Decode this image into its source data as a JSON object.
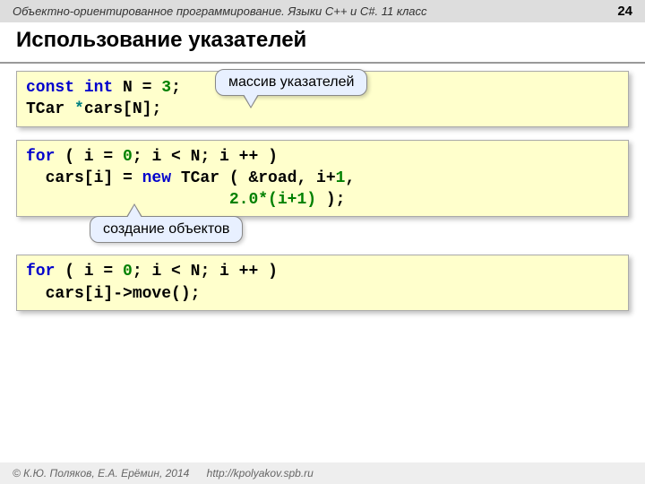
{
  "header": {
    "course": "Объектно-ориентированное программирование. Языки C++ и C#. 11 класс",
    "page": "24"
  },
  "title": "Использование указателей",
  "code1": {
    "l1_const": "const",
    "l1_int": "int",
    "l1_n": " N = ",
    "l1_3": "3",
    "l1_semi": ";",
    "l2_tcar": "TCar ",
    "l2_star": "*",
    "l2_rest": "cars[N];"
  },
  "callout1": "массив указателей",
  "code2": {
    "l1_for": "for",
    "l1_mid": " ( i = ",
    "l1_0": "0",
    "l1_end": "; i < N; i ++ )",
    "l2_pre": "  cars[i] = ",
    "l2_new": "new",
    "l2_mid": " TCar ( &road, i+",
    "l2_1": "1",
    "l2_comma": ",",
    "l3_pad": "                     ",
    "l3_expr": "2.0*(i+1)",
    "l3_end": " );"
  },
  "callout2": "создание объектов",
  "code3": {
    "l1_for": "for",
    "l1_mid": " ( i = ",
    "l1_0": "0",
    "l1_end": "; i < N; i ++ )",
    "l2": "  cars[i]->move();"
  },
  "footer": {
    "copyright": "© К.Ю. Поляков, Е.А. Ерёмин, 2014",
    "url": "http://kpolyakov.spb.ru"
  }
}
